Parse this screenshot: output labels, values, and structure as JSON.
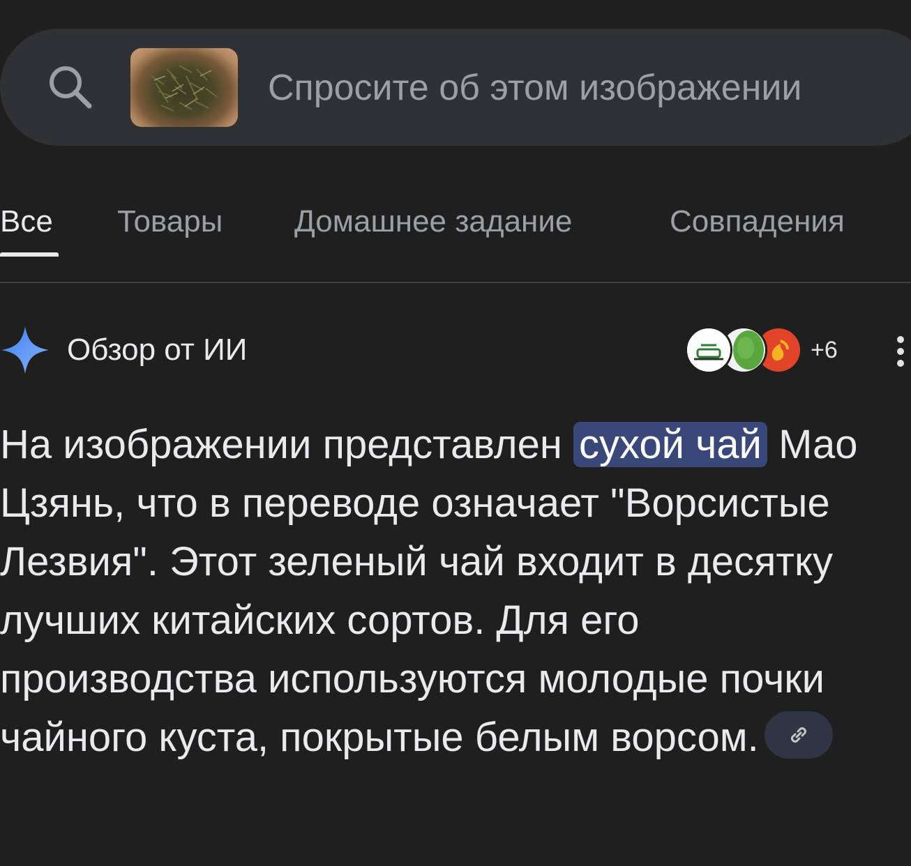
{
  "search": {
    "placeholder": "Спросите об этом изображении",
    "image_thumbnail": "dried-tea-leaves"
  },
  "tabs": [
    {
      "label": "Все",
      "active": true
    },
    {
      "label": "Товары",
      "active": false
    },
    {
      "label": "Домашнее задание",
      "active": false
    },
    {
      "label": "Совпадения",
      "active": false
    }
  ],
  "ai_overview": {
    "title": "Обзор от ИИ",
    "icon": "gemini-sparkle-icon",
    "sources_extra": "+6",
    "text_before": "На изображении представлен ",
    "highlight": "сухой чай",
    "text_after": " Мао Цзянь, что в переводе означает \"Ворсистые Лезвия\". Этот зеленый чай входит в десятку лучших китайских сортов. Для его производства используются молодые почки чайного куста, покрытые белым ворсом."
  },
  "colors": {
    "background": "#1f1f1f",
    "search_bar": "#303134",
    "highlight": "#394779",
    "gemini_blue": "#4a8af4"
  }
}
